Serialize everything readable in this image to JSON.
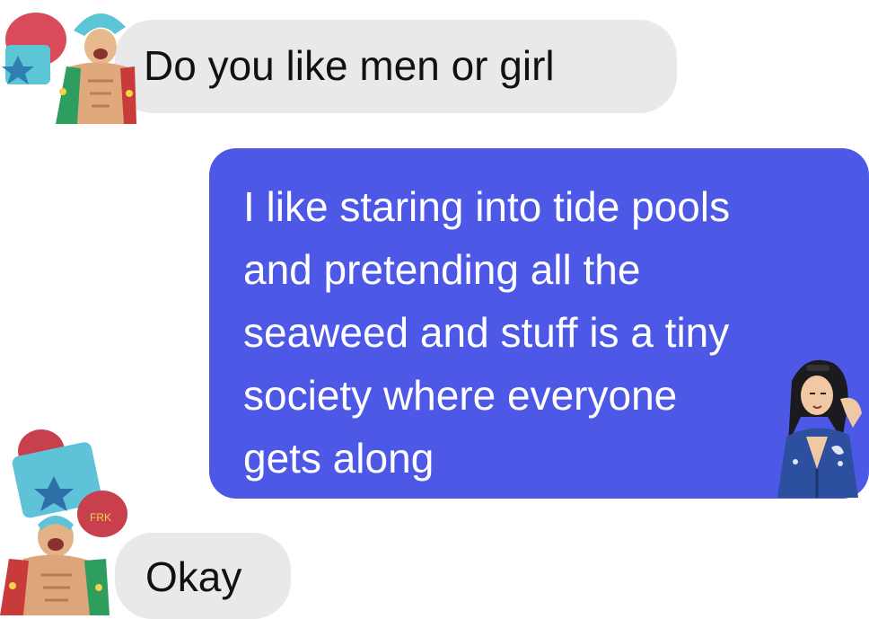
{
  "conversation": {
    "messages": [
      {
        "sender": "other",
        "text": "Do you like men or girl"
      },
      {
        "sender": "me",
        "lines": [
          "I like staring into tide pools",
          "and pretending all the",
          "seaweed and stuff is a tiny",
          "society where everyone",
          "gets along"
        ]
      },
      {
        "sender": "other",
        "text": "Okay"
      }
    ]
  },
  "avatars": {
    "top": "franky-sticker",
    "bottom": "franky-sticker",
    "right": "robin-sticker"
  },
  "colors": {
    "incoming_bubble": "#e9e9eb",
    "outgoing_bubble": "#4d59e6",
    "outgoing_text": "#ffffff",
    "incoming_text": "#111111"
  }
}
